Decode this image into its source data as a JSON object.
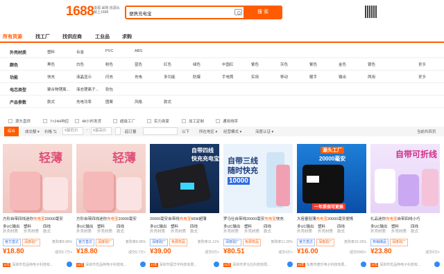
{
  "header": {
    "logo": "1688",
    "slogan": [
      "货源 采购 找源头",
      "就上1688"
    ],
    "search_value": "便携充电宝",
    "search_button": "搜 索"
  },
  "tabs": [
    "所有货源",
    "找工厂",
    "找供应商",
    "工业品",
    "求购"
  ],
  "filters": [
    {
      "label": "外壳材质",
      "options": [
        "塑料",
        "合金",
        "PVC",
        "ABS"
      ],
      "more": ""
    },
    {
      "label": "颜色",
      "options": [
        "黑色",
        "白色",
        "粉色",
        "蓝色",
        "红色",
        "绿色",
        "中国红",
        "紫色",
        "灰色",
        "紫色",
        "金色",
        "银色"
      ],
      "more": "更多"
    },
    {
      "label": "功能",
      "options": [
        "快充",
        "液晶显示",
        "闪充",
        "充电",
        "多功能",
        "防爆",
        "手电筒",
        "实用",
        "移动",
        "暖手",
        "输出",
        "两用"
      ],
      "more": "更多"
    },
    {
      "label": "电芯类型",
      "options": [
        "聚合物锂离...",
        "液态锂离子...",
        "软包"
      ],
      "more": ""
    },
    {
      "label": "产品参数",
      "options": [
        "款式",
        "充电功率",
        "图案",
        "风格",
        "款式"
      ],
      "more": ""
    }
  ],
  "checkboxes": [
    "源头直供",
    "7×24H响应",
    "48小时发货",
    "超级工厂",
    "实力商家",
    "加工定制",
    "通用排序"
  ],
  "sortbar": {
    "items": [
      "综合",
      "成交额",
      "价格",
      "起订量",
      "所在地区",
      "经营模式",
      "深度认证"
    ],
    "price_min": "¥最低价",
    "price_max": "¥最高价",
    "moq_unit": "以下",
    "right": "当前共四页"
  },
  "products": [
    {
      "title_pre": "方形自带四线迷你",
      "title_hl": "充电宝",
      "title_post": "20000毫安",
      "spec1": [
        "多UC输出",
        "外壳材质"
      ],
      "spec2": [
        "塑料",
        "外壳材质"
      ],
      "spec3": [
        "四线",
        "款式"
      ],
      "tag1": "官方直达",
      "tag2": "深度验厂",
      "rate": "复购率8.96%",
      "price": "¥18.80",
      "sold": "成交6.7万+",
      "years": "11年",
      "shop": "深圳市优品特电子科技有..."
    },
    {
      "title_pre": "方形自带四线迷你",
      "title_hl": "充电宝",
      "title_post": "20000毫安",
      "spec1": [
        "多UC输出",
        "外壳材质"
      ],
      "spec2": [
        "塑料",
        "外壳材质"
      ],
      "spec3": [
        "四线",
        "款式"
      ],
      "tag1": "官方直达",
      "tag2": "深度验厂",
      "rate": "复购率8.96%",
      "price": "¥18.80",
      "sold": "成交6.7万+",
      "years": "11年",
      "shop": "深圳市优品特电子科技有..."
    },
    {
      "title_pre": "20000毫安自带线",
      "title_hl": "充电宝",
      "title_post": "66W超薄",
      "spec1": [
        "多UC输出",
        "外壳材质"
      ],
      "spec2": [
        "塑料",
        "外壳材质"
      ],
      "spec3": [
        "四线",
        "款式"
      ],
      "tag1": "深度验厂",
      "tag2": "免费样品",
      "rate": "复购率11.11%",
      "price": "¥39.00",
      "sold": "成交9万+",
      "years": "12年",
      "shop": "深圳市因华宇科技有限..."
    },
    {
      "title_pre": "罗马仕自带线20000毫安",
      "title_hl": "充电宝",
      "title_post": "快充",
      "spec1": [
        "多UC输出",
        "外壳材质"
      ],
      "spec2": [
        "塑料",
        "外壳材质"
      ],
      "spec3": [
        "四线",
        "款式"
      ],
      "tag1": "深度验厂",
      "tag2": "免费样品",
      "rate": "复购率11.33%",
      "price": "¥80.51",
      "sold": "成交4万+",
      "years": "11年",
      "shop": "深圳市罗马仕科技有限..."
    },
    {
      "title_pre": "大容量轻薄",
      "title_hl": "充电宝",
      "title_post": "20000毫安便携",
      "spec1": [
        "多UC输出",
        "外壳材质"
      ],
      "spec2": [
        "塑料",
        "外壳材质"
      ],
      "spec3": [
        "四线",
        "款式"
      ],
      "tag1": "官方直达",
      "tag2": "深度验厂",
      "rate": "复购率33.33%",
      "price": "¥16.00",
      "sold": "成交6000+",
      "years": "10年",
      "shop": "东莞市德乐电子科技有限..."
    },
    {
      "title_pre": "礼品迷你",
      "title_hl": "充电宝",
      "title_post": "自带四线小巧",
      "spec1": [
        "多UC输出",
        "外壳材质"
      ],
      "spec2": [
        "塑料",
        "外壳材质"
      ],
      "spec3": [
        "四线",
        "款式"
      ],
      "tag1": "热销爆品",
      "tag2": "深度验厂",
      "rate": "",
      "price": "¥23.80",
      "sold": "成交6万+",
      "years": "11年",
      "shop": "深圳市优品特电子科技有..."
    }
  ],
  "colors": {
    "brand": "#ff5b00"
  }
}
